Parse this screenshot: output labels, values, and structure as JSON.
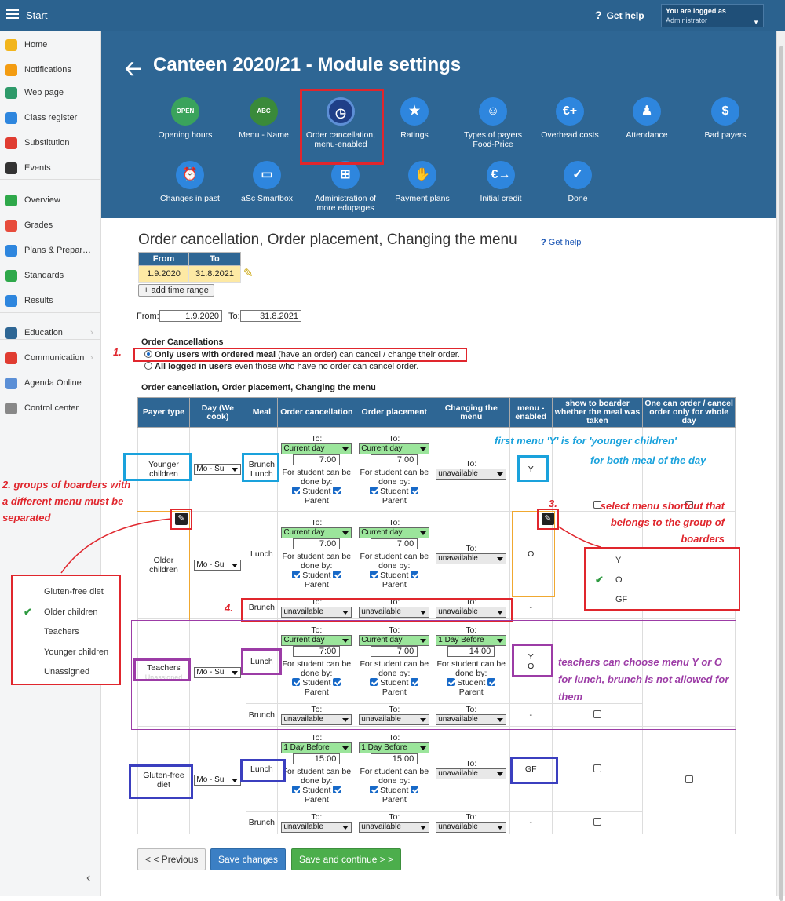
{
  "topbar": {
    "start": "Start",
    "help": "Get help",
    "logged_in_as": "You are logged as",
    "user": "Administrator"
  },
  "sidebar": {
    "items": [
      {
        "label": "Home",
        "icon": "star-icon",
        "color": "#f2b51c"
      },
      {
        "label": "Notifications",
        "icon": "envelope-icon",
        "color": "#f39c12"
      },
      {
        "label": "Web page",
        "icon": "house-icon",
        "color": "#2e9a6a"
      },
      {
        "label": "Class register",
        "icon": "book-icon",
        "color": "#2e86de"
      },
      {
        "label": "Substitution",
        "icon": "person-icon",
        "color": "#e03c31"
      },
      {
        "label": "Events",
        "icon": "calendar-icon",
        "color": "#333333"
      },
      {
        "label": "Overview",
        "icon": "check-circle-icon",
        "color": "#2ea84a"
      },
      {
        "label": "Grades",
        "icon": "grades-icon",
        "color": "#e74c3c"
      },
      {
        "label": "Plans & Prepar…",
        "icon": "briefcase-icon",
        "color": "#2e86de"
      },
      {
        "label": "Standards",
        "icon": "shield-icon",
        "color": "#2ea84a"
      },
      {
        "label": "Results",
        "icon": "bar-chart-icon",
        "color": "#2e86de"
      },
      {
        "label": "Education",
        "icon": "education-icon",
        "color": "#2e6694"
      },
      {
        "label": "Communication",
        "icon": "chat-icon",
        "color": "#e03c31"
      },
      {
        "label": "Agenda Online",
        "icon": "pen-icon",
        "color": "#5b8fd6"
      },
      {
        "label": "Control center",
        "icon": "gear-icon",
        "color": "#888888"
      }
    ]
  },
  "header": {
    "title": "Canteen 2020/21 - Module settings",
    "tiles": [
      {
        "label": "Opening hours",
        "icon": "open-sign-icon",
        "glyph": "OPEN",
        "color": "#3aa35c"
      },
      {
        "label": "Menu - Name",
        "icon": "abc-icon",
        "glyph": "ABC",
        "color": "#3a8a3a"
      },
      {
        "label": "Order cancellation, menu-enabled",
        "icon": "clock-icon",
        "glyph": "◷",
        "color": "#2a4d9a"
      },
      {
        "label": "Ratings",
        "icon": "star-icon",
        "glyph": "★",
        "color": "#2e86de"
      },
      {
        "label": "Types of payers Food-Price",
        "icon": "payers-icon",
        "glyph": "☺",
        "color": "#2e86de"
      },
      {
        "label": "Overhead costs",
        "icon": "euro-plus-icon",
        "glyph": "€+",
        "color": "#2e86de"
      },
      {
        "label": "Attendance",
        "icon": "walking-icon",
        "glyph": "♟",
        "color": "#2e86de"
      },
      {
        "label": "Bad payers",
        "icon": "money-bag-icon",
        "glyph": "$",
        "color": "#2e86de"
      },
      {
        "label": "Changes in past",
        "icon": "alarm-clock-icon",
        "glyph": "⏰",
        "color": "#2e86de"
      },
      {
        "label": "aSc Smartbox",
        "icon": "monitor-icon",
        "glyph": "▭",
        "color": "#2e86de"
      },
      {
        "label": "Administration of more edupages",
        "icon": "org-chart-icon",
        "glyph": "⊞",
        "color": "#2e86de"
      },
      {
        "label": "Payment plans",
        "icon": "handshake-icon",
        "glyph": "✋",
        "color": "#2e86de"
      },
      {
        "label": "Initial credit",
        "icon": "euro-arrow-icon",
        "glyph": "€→",
        "color": "#2e86de"
      },
      {
        "label": "Done",
        "icon": "checkmark-icon",
        "glyph": "✓",
        "color": "#2e86de"
      }
    ]
  },
  "section": {
    "title": "Order cancellation, Order placement, Changing the menu",
    "help": "Get help",
    "range_headers": [
      "From",
      "To"
    ],
    "range_from": "1.9.2020",
    "range_to": "31.8.2021",
    "add_range": "+ add time range",
    "from_label": "From:",
    "to_label": "To:",
    "from_value": "1.9.2020",
    "to_value": "31.8.2021",
    "cancellations_title": "Order Cancellations",
    "opt1_bold": "Only users with ordered meal",
    "opt1_rest": " (have an order) can cancel / change their order.",
    "opt2_bold": "All logged in users",
    "opt2_rest": " even those who have no order can cancel order.",
    "grid_title": "Order cancellation, Order placement, Changing the menu"
  },
  "grid": {
    "headers": [
      "Payer type",
      "Day (We cook)",
      "Meal",
      "Order cancellation",
      "Order placement",
      "Changing the menu",
      "menu - enabled",
      "show to boarder whether the meal was taken",
      "One can order / cancel order only for whole day"
    ],
    "to": "To:",
    "for_student": "For student can be done by:",
    "student": "Student",
    "parent": "Parent",
    "unavailable": "unavailable",
    "current_day": "Current day",
    "one_day_before": "1 Day Before",
    "day_range": "Mo - Su",
    "dash": "-",
    "groups": {
      "younger": {
        "name": "Younger children",
        "meal": "Brunch Lunch",
        "time": "7:00",
        "menu": "Y"
      },
      "older": {
        "name": "Older children",
        "meal": "Lunch",
        "meal2": "Brunch",
        "time": "7:00",
        "menu": "O"
      },
      "teachers": {
        "name": "Teachers",
        "ghost": "Unassigned",
        "meal": "Lunch",
        "meal2": "Brunch",
        "time": "7:00",
        "change_time": "14:00",
        "menu1": "Y",
        "menu2": "O"
      },
      "gluten": {
        "name": "Gluten-free diet",
        "meal": "Lunch",
        "meal2": "Brunch",
        "time": "15:00",
        "menu": "GF"
      }
    }
  },
  "buttons": {
    "previous": "< < Previous",
    "save": "Save changes",
    "save_continue": "Save and continue > >"
  },
  "annotations": {
    "n1": "1.",
    "n2": "2. groups of boarders with a different menu must be separated",
    "n3": "3.",
    "n3_text": "select menu shortcut that belongs to the group of boarders",
    "n4": "4.",
    "blue1": "first menu 'Y' is for  'younger children'",
    "blue2": "for both meal of the day",
    "purple": "teachers can choose menu Y or O for lunch, brunch is not allowed for them"
  },
  "popup_left": {
    "options": [
      "Gluten-free diet",
      "Older children",
      "Teachers",
      "Younger children",
      "Unassigned"
    ],
    "selected": "Older children"
  },
  "popup_right": {
    "options": [
      "Y",
      "O",
      "GF"
    ],
    "selected": "O"
  },
  "colors": {
    "red": "#e0262d",
    "blue": "#1aa2dc",
    "purple": "#9c3ca6",
    "navy": "#3b3fbf",
    "orange": "#f0a830",
    "header": "#2e6694"
  }
}
